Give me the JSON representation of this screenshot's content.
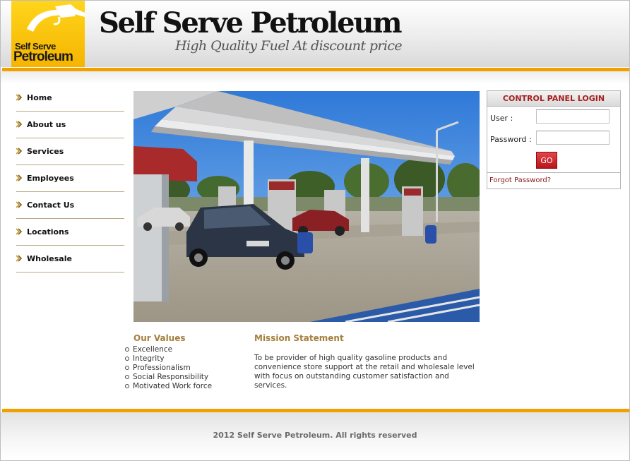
{
  "brand": {
    "logo_line1": "Self Serve",
    "logo_line2": "Petroleum",
    "title": "Self Serve Petroleum",
    "tagline": "High Quality Fuel At discount price"
  },
  "nav": {
    "items": [
      {
        "label": "Home"
      },
      {
        "label": "About us"
      },
      {
        "label": "Services"
      },
      {
        "label": "Employees"
      },
      {
        "label": "Contact Us"
      },
      {
        "label": "Locations"
      },
      {
        "label": "Wholesale"
      }
    ]
  },
  "login": {
    "title": "CONTROL PANEL LOGIN",
    "user_label": "User :",
    "user_value": "",
    "password_label": "Password :",
    "password_value": "",
    "go_label": "GO",
    "forgot_label": "Forgot Password?"
  },
  "values": {
    "title": "Our Values",
    "items": [
      "Excellence",
      "Integrity",
      "Professionalism",
      "Social Responsibility",
      "Motivated Work force"
    ]
  },
  "mission": {
    "title": "Mission Statement",
    "text": "To be provider of high quality gasoline products and convenience store support at the retail and wholesale level with focus on outstanding customer satisfaction and services."
  },
  "footer": {
    "text": "2012 Self Serve Petroleum. All rights reserved"
  },
  "colors": {
    "accent_orange": "#f0a100",
    "logo_yellow": "#ffd51c",
    "heading_gold": "#a4803e",
    "login_red": "#a52020",
    "button_red": "#c8272c"
  }
}
